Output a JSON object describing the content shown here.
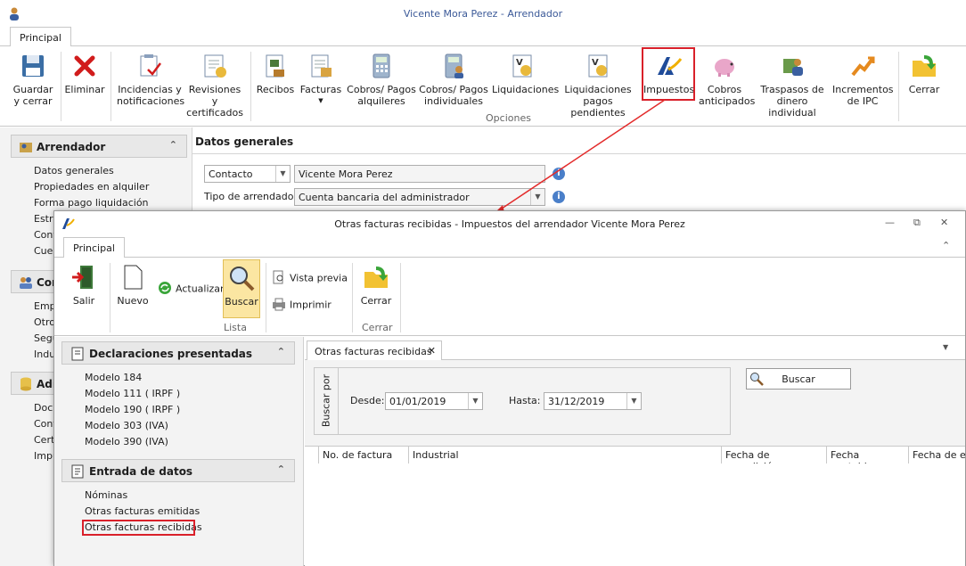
{
  "window": {
    "title": "Vicente Mora Perez - Arrendador"
  },
  "tabs": {
    "principal": "Principal"
  },
  "ribbon": {
    "guardar_l1": "Guardar",
    "guardar_l2": "y cerrar",
    "eliminar": "Eliminar",
    "incid_l1": "Incidencias y",
    "incid_l2": "notificaciones",
    "rev_l1": "Revisiones y",
    "rev_l2": "certificados",
    "recibos": "Recibos",
    "facturas": "Facturas",
    "cobros_alq_l1": "Cobros/ Pagos",
    "cobros_alq_l2": "alquileres",
    "cobros_ind_l1": "Cobros/ Pagos",
    "cobros_ind_l2": "individuales",
    "liquidaciones": "Liquidaciones",
    "liq_pend_l1": "Liquidaciones",
    "liq_pend_l2": "pagos pendientes",
    "impuestos": "Impuestos",
    "cobros_ant_l1": "Cobros",
    "cobros_ant_l2": "anticipados",
    "traspasos_l1": "Traspasos de",
    "traspasos_l2": "dinero individual",
    "ipc_l1": "Incrementos",
    "ipc_l2": "de IPC",
    "cerrar": "Cerrar",
    "group_opciones": "Opciones"
  },
  "left": {
    "header": "Arrendador",
    "items": [
      "Datos generales",
      "Propiedades en alquiler",
      "Forma pago liquidación",
      "Estr",
      "Cont",
      "Cuer"
    ],
    "header2": "Con",
    "items2": [
      "Empl",
      "Otro",
      "Segu",
      "Indu"
    ],
    "header3": "Adi",
    "items3": [
      "Docu",
      "Conf",
      "Cert",
      "Impu"
    ]
  },
  "main": {
    "section_title": "Datos generales",
    "contacto_select": "Contacto",
    "contacto_value": "Vicente Mora Perez",
    "tipo_label": "Tipo de arrendador:",
    "tipo_value": "Cuenta bancaria del administrador"
  },
  "dialog": {
    "title": "Otras facturas recibidas - Impuestos del arrendador Vicente Mora Perez",
    "tab": "Principal",
    "salir": "Salir",
    "nuevo": "Nuevo",
    "actualizar": "Actualizar",
    "buscar": "Buscar",
    "vista_previa": "Vista previa",
    "imprimir": "Imprimir",
    "cerrar": "Cerrar",
    "group_lista": "Lista",
    "group_cerrar": "Cerrar",
    "panel1": "Declaraciones presentadas",
    "panel1_items": [
      "Modelo 184",
      "Modelo 111 ( IRPF )",
      "Modelo 190 ( IRPF )",
      "Modelo 303 (IVA)",
      "Modelo 390 (IVA)"
    ],
    "panel2": "Entrada de datos",
    "panel2_items": [
      "Nóminas",
      "Otras facturas emitidas",
      "Otras facturas recibidas"
    ],
    "doc_tab": "Otras facturas recibidas",
    "buscar_por": "Buscar por",
    "desde_label": "Desde:",
    "desde_value": "01/01/2019",
    "hasta_label": "Hasta:",
    "hasta_value": "31/12/2019",
    "buscar_btn": "Buscar",
    "columns": [
      "No. de factura",
      "Industrial",
      "Fecha de expedición",
      "Fecha contable",
      "Fecha de e"
    ]
  }
}
